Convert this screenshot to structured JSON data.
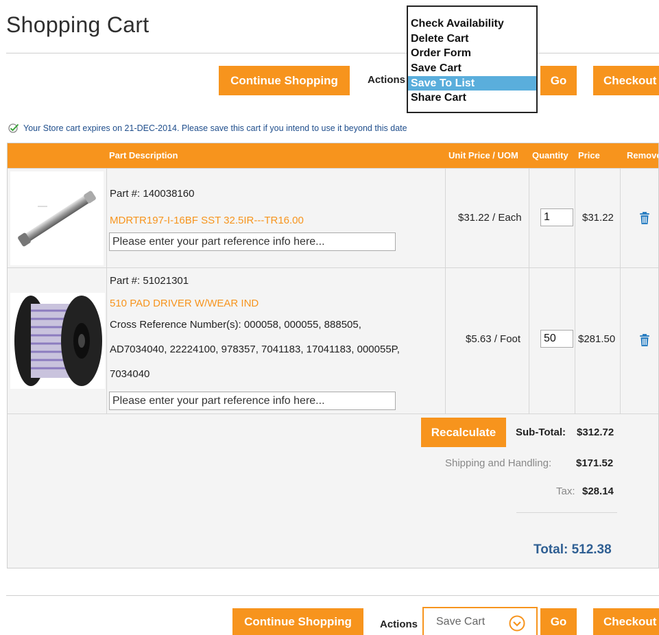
{
  "page": {
    "title": "Shopping Cart"
  },
  "toolbar_top": {
    "continue_label": "Continue Shopping",
    "actions_label": "Actions",
    "go_label": "Go",
    "checkout_label": "Checkout",
    "dropdown_options": [
      "Check Availability",
      "Delete Cart",
      "Order Form",
      "Save Cart",
      "Save To List",
      "Share Cart"
    ],
    "dropdown_selected": "Save To List"
  },
  "notice": {
    "text": "Your Store cart expires on 21-DEC-2014. Please save this cart if you intend to use it beyond this date",
    "icon": "checkmark-icon"
  },
  "table": {
    "headers": {
      "description": "Part Description",
      "unit_price": "Unit Price / UOM",
      "quantity": "Quantity",
      "price": "Price",
      "remove": "Remove"
    }
  },
  "items": [
    {
      "part_number": "Part #: 140038160",
      "name": "MDRTR197-I-16BF SST 32.5IR---TR16.00",
      "cross_reference": [],
      "ref_placeholder": "Please enter your part reference info here...",
      "unit_price": "$31.22 / Each",
      "quantity": "1",
      "price": "$31.22",
      "image": "metal-rod-image"
    },
    {
      "part_number": "Part #: 51021301",
      "name": "510 PAD DRIVER W/WEAR IND",
      "cross_reference": [
        "Cross Reference Number(s): 000058, 000055, 888505,",
        "AD7034040, 22224100, 978357, 7041183, 17041183, 000055P,",
        "7034040"
      ],
      "ref_placeholder": "Please enter your part reference info here...",
      "unit_price": "$5.63 / Foot",
      "quantity": "50",
      "price": "$281.50",
      "image": "pad-driver-image"
    }
  ],
  "summary": {
    "recalculate_label": "Recalculate",
    "subtotal_label": "Sub-Total:",
    "subtotal_value": "$312.72",
    "shipping_label": "Shipping and Handling:",
    "shipping_value": "$171.52",
    "tax_label": "Tax:",
    "tax_value": "$28.14",
    "total_text": "Total: 512.38"
  },
  "toolbar_bottom": {
    "continue_label": "Continue Shopping",
    "actions_label": "Actions",
    "select_value": "Save Cart",
    "go_label": "Go",
    "checkout_label": "Checkout"
  },
  "colors": {
    "accent": "#f7941d",
    "link_blue": "#2f5f93",
    "highlight": "#5aaedc",
    "row_bg": "#f4f4f4"
  }
}
